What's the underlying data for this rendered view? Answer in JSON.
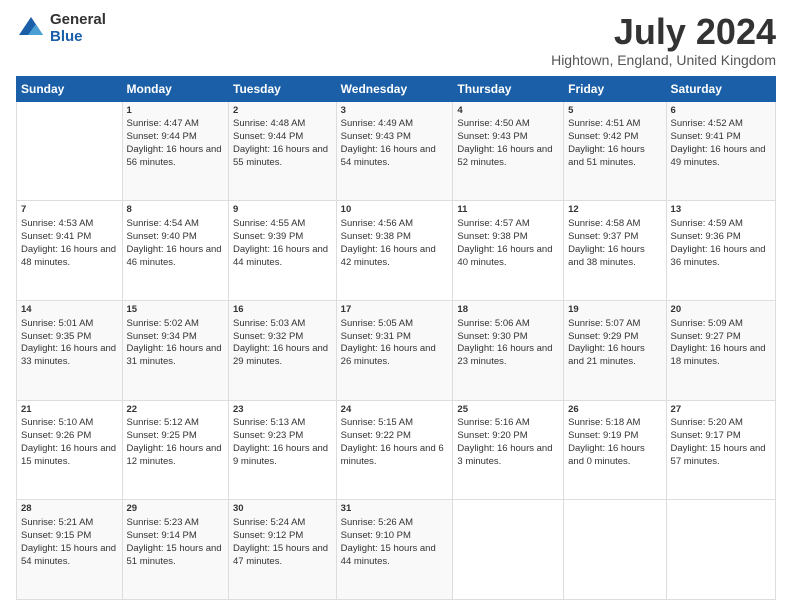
{
  "header": {
    "logo_general": "General",
    "logo_blue": "Blue",
    "title": "July 2024",
    "subtitle": "Hightown, England, United Kingdom"
  },
  "days_header": [
    "Sunday",
    "Monday",
    "Tuesday",
    "Wednesday",
    "Thursday",
    "Friday",
    "Saturday"
  ],
  "weeks": [
    [
      {
        "day": "",
        "sunrise": "",
        "sunset": "",
        "daylight": ""
      },
      {
        "day": "1",
        "sunrise": "Sunrise: 4:47 AM",
        "sunset": "Sunset: 9:44 PM",
        "daylight": "Daylight: 16 hours and 56 minutes."
      },
      {
        "day": "2",
        "sunrise": "Sunrise: 4:48 AM",
        "sunset": "Sunset: 9:44 PM",
        "daylight": "Daylight: 16 hours and 55 minutes."
      },
      {
        "day": "3",
        "sunrise": "Sunrise: 4:49 AM",
        "sunset": "Sunset: 9:43 PM",
        "daylight": "Daylight: 16 hours and 54 minutes."
      },
      {
        "day": "4",
        "sunrise": "Sunrise: 4:50 AM",
        "sunset": "Sunset: 9:43 PM",
        "daylight": "Daylight: 16 hours and 52 minutes."
      },
      {
        "day": "5",
        "sunrise": "Sunrise: 4:51 AM",
        "sunset": "Sunset: 9:42 PM",
        "daylight": "Daylight: 16 hours and 51 minutes."
      },
      {
        "day": "6",
        "sunrise": "Sunrise: 4:52 AM",
        "sunset": "Sunset: 9:41 PM",
        "daylight": "Daylight: 16 hours and 49 minutes."
      }
    ],
    [
      {
        "day": "7",
        "sunrise": "Sunrise: 4:53 AM",
        "sunset": "Sunset: 9:41 PM",
        "daylight": "Daylight: 16 hours and 48 minutes."
      },
      {
        "day": "8",
        "sunrise": "Sunrise: 4:54 AM",
        "sunset": "Sunset: 9:40 PM",
        "daylight": "Daylight: 16 hours and 46 minutes."
      },
      {
        "day": "9",
        "sunrise": "Sunrise: 4:55 AM",
        "sunset": "Sunset: 9:39 PM",
        "daylight": "Daylight: 16 hours and 44 minutes."
      },
      {
        "day": "10",
        "sunrise": "Sunrise: 4:56 AM",
        "sunset": "Sunset: 9:38 PM",
        "daylight": "Daylight: 16 hours and 42 minutes."
      },
      {
        "day": "11",
        "sunrise": "Sunrise: 4:57 AM",
        "sunset": "Sunset: 9:38 PM",
        "daylight": "Daylight: 16 hours and 40 minutes."
      },
      {
        "day": "12",
        "sunrise": "Sunrise: 4:58 AM",
        "sunset": "Sunset: 9:37 PM",
        "daylight": "Daylight: 16 hours and 38 minutes."
      },
      {
        "day": "13",
        "sunrise": "Sunrise: 4:59 AM",
        "sunset": "Sunset: 9:36 PM",
        "daylight": "Daylight: 16 hours and 36 minutes."
      }
    ],
    [
      {
        "day": "14",
        "sunrise": "Sunrise: 5:01 AM",
        "sunset": "Sunset: 9:35 PM",
        "daylight": "Daylight: 16 hours and 33 minutes."
      },
      {
        "day": "15",
        "sunrise": "Sunrise: 5:02 AM",
        "sunset": "Sunset: 9:34 PM",
        "daylight": "Daylight: 16 hours and 31 minutes."
      },
      {
        "day": "16",
        "sunrise": "Sunrise: 5:03 AM",
        "sunset": "Sunset: 9:32 PM",
        "daylight": "Daylight: 16 hours and 29 minutes."
      },
      {
        "day": "17",
        "sunrise": "Sunrise: 5:05 AM",
        "sunset": "Sunset: 9:31 PM",
        "daylight": "Daylight: 16 hours and 26 minutes."
      },
      {
        "day": "18",
        "sunrise": "Sunrise: 5:06 AM",
        "sunset": "Sunset: 9:30 PM",
        "daylight": "Daylight: 16 hours and 23 minutes."
      },
      {
        "day": "19",
        "sunrise": "Sunrise: 5:07 AM",
        "sunset": "Sunset: 9:29 PM",
        "daylight": "Daylight: 16 hours and 21 minutes."
      },
      {
        "day": "20",
        "sunrise": "Sunrise: 5:09 AM",
        "sunset": "Sunset: 9:27 PM",
        "daylight": "Daylight: 16 hours and 18 minutes."
      }
    ],
    [
      {
        "day": "21",
        "sunrise": "Sunrise: 5:10 AM",
        "sunset": "Sunset: 9:26 PM",
        "daylight": "Daylight: 16 hours and 15 minutes."
      },
      {
        "day": "22",
        "sunrise": "Sunrise: 5:12 AM",
        "sunset": "Sunset: 9:25 PM",
        "daylight": "Daylight: 16 hours and 12 minutes."
      },
      {
        "day": "23",
        "sunrise": "Sunrise: 5:13 AM",
        "sunset": "Sunset: 9:23 PM",
        "daylight": "Daylight: 16 hours and 9 minutes."
      },
      {
        "day": "24",
        "sunrise": "Sunrise: 5:15 AM",
        "sunset": "Sunset: 9:22 PM",
        "daylight": "Daylight: 16 hours and 6 minutes."
      },
      {
        "day": "25",
        "sunrise": "Sunrise: 5:16 AM",
        "sunset": "Sunset: 9:20 PM",
        "daylight": "Daylight: 16 hours and 3 minutes."
      },
      {
        "day": "26",
        "sunrise": "Sunrise: 5:18 AM",
        "sunset": "Sunset: 9:19 PM",
        "daylight": "Daylight: 16 hours and 0 minutes."
      },
      {
        "day": "27",
        "sunrise": "Sunrise: 5:20 AM",
        "sunset": "Sunset: 9:17 PM",
        "daylight": "Daylight: 15 hours and 57 minutes."
      }
    ],
    [
      {
        "day": "28",
        "sunrise": "Sunrise: 5:21 AM",
        "sunset": "Sunset: 9:15 PM",
        "daylight": "Daylight: 15 hours and 54 minutes."
      },
      {
        "day": "29",
        "sunrise": "Sunrise: 5:23 AM",
        "sunset": "Sunset: 9:14 PM",
        "daylight": "Daylight: 15 hours and 51 minutes."
      },
      {
        "day": "30",
        "sunrise": "Sunrise: 5:24 AM",
        "sunset": "Sunset: 9:12 PM",
        "daylight": "Daylight: 15 hours and 47 minutes."
      },
      {
        "day": "31",
        "sunrise": "Sunrise: 5:26 AM",
        "sunset": "Sunset: 9:10 PM",
        "daylight": "Daylight: 15 hours and 44 minutes."
      },
      {
        "day": "",
        "sunrise": "",
        "sunset": "",
        "daylight": ""
      },
      {
        "day": "",
        "sunrise": "",
        "sunset": "",
        "daylight": ""
      },
      {
        "day": "",
        "sunrise": "",
        "sunset": "",
        "daylight": ""
      }
    ]
  ]
}
